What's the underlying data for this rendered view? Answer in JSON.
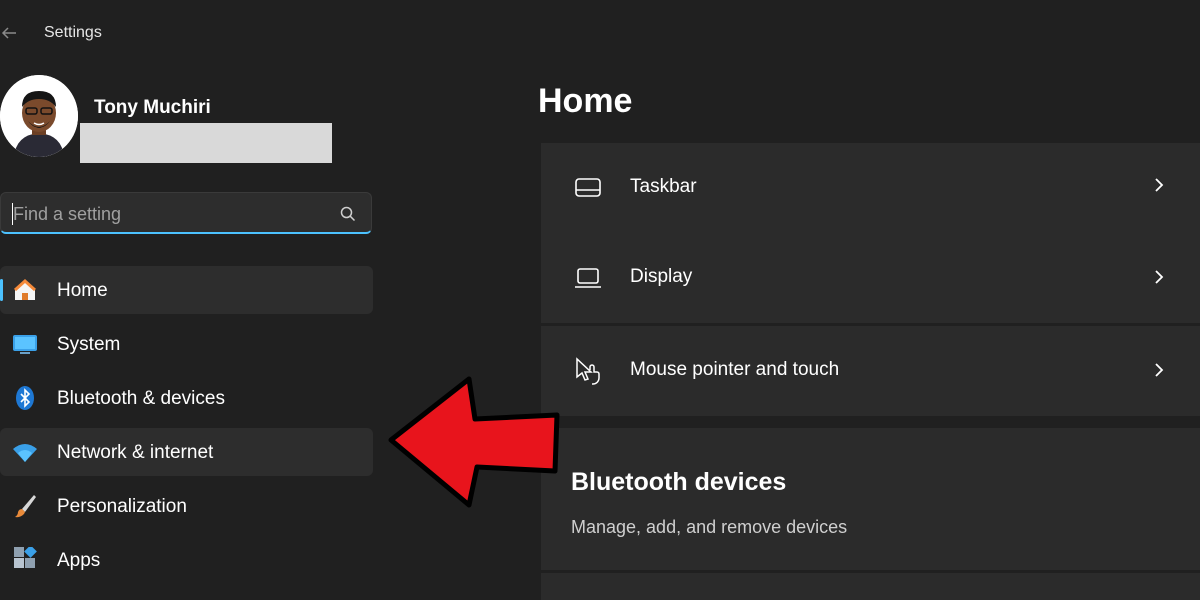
{
  "app": {
    "title": "Settings"
  },
  "profile": {
    "name": "Tony Muchiri"
  },
  "search": {
    "placeholder": "Find a setting"
  },
  "sidebar": {
    "items": [
      {
        "label": "Home",
        "icon": "home-icon"
      },
      {
        "label": "System",
        "icon": "system-icon"
      },
      {
        "label": "Bluetooth & devices",
        "icon": "bluetooth-icon"
      },
      {
        "label": "Network & internet",
        "icon": "wifi-icon"
      },
      {
        "label": "Personalization",
        "icon": "brush-icon"
      },
      {
        "label": "Apps",
        "icon": "apps-icon"
      }
    ]
  },
  "main": {
    "title": "Home",
    "cards": [
      {
        "label": "Taskbar",
        "icon": "taskbar-icon"
      },
      {
        "label": "Display",
        "icon": "display-icon"
      },
      {
        "label": "Mouse pointer and touch",
        "icon": "mouse-touch-icon"
      }
    ],
    "bluetooth_section": {
      "title": "Bluetooth devices",
      "subtitle": "Manage, add, and remove devices"
    }
  },
  "colors": {
    "background": "#202020",
    "card": "#2b2b2b",
    "accent": "#4cc2ff",
    "annotation_arrow": "#e8141c"
  }
}
